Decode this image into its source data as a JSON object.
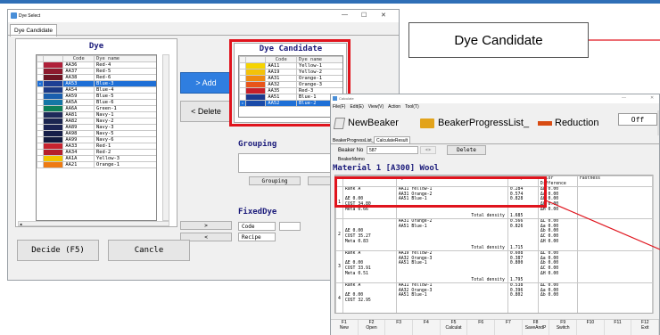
{
  "win1": {
    "title": "Dye Select",
    "tab": "Dye Candidate",
    "dye_panel": {
      "title": "Dye",
      "col_code": "Code",
      "col_name": "Dye name",
      "rows": [
        {
          "code": "AA36",
          "name": "Red-4",
          "color": "#b0203a"
        },
        {
          "code": "AA37",
          "name": "Red-5",
          "color": "#8e1a2e"
        },
        {
          "code": "AA38",
          "name": "Red-6",
          "color": "#6d1423"
        },
        {
          "code": "AA53",
          "name": "Blue-3",
          "color": "#1d3f95",
          "selected": true
        },
        {
          "code": "AA54",
          "name": "Blue-4",
          "color": "#1b3a86"
        },
        {
          "code": "AA59",
          "name": "Blue-5",
          "color": "#1a5fae"
        },
        {
          "code": "AA5A",
          "name": "Blue-6",
          "color": "#1477a6"
        },
        {
          "code": "AA6A",
          "name": "Green-1",
          "color": "#0f7f59"
        },
        {
          "code": "AA81",
          "name": "Navy-1",
          "color": "#1e2a5a"
        },
        {
          "code": "AA82",
          "name": "Navy-2",
          "color": "#1b2550"
        },
        {
          "code": "AA89",
          "name": "Navy-3",
          "color": "#1b2353"
        },
        {
          "code": "AA98",
          "name": "Navy-5",
          "color": "#151d48"
        },
        {
          "code": "AA99",
          "name": "Navy-6",
          "color": "#121a3f"
        },
        {
          "code": "AA33",
          "name": "Red-1",
          "color": "#c8232f"
        },
        {
          "code": "AA34",
          "name": "Red-2",
          "color": "#b51f2c"
        },
        {
          "code": "AA1A",
          "name": "Yellow-3",
          "color": "#f2c400"
        },
        {
          "code": "AA21",
          "name": "Orange-1",
          "color": "#ee7a12"
        }
      ]
    },
    "add_label": "> Add",
    "delete_label": "< Delete",
    "candidate_panel": {
      "title": "Dye Candidate",
      "col_code": "Code",
      "col_name": "Dye name",
      "rows": [
        {
          "code": "AA11",
          "name": "Yellow-1",
          "color": "#f6d400"
        },
        {
          "code": "AA19",
          "name": "Yellow-2",
          "color": "#f3c20a"
        },
        {
          "code": "AA31",
          "name": "Orange-1",
          "color": "#f08a10"
        },
        {
          "code": "AA32",
          "name": "Orange-3",
          "color": "#e8541a"
        },
        {
          "code": "AA35",
          "name": "Red-3",
          "color": "#c81f2a"
        },
        {
          "code": "AA51",
          "name": "Blue-1",
          "color": "#1c3a8f"
        },
        {
          "code": "AA52",
          "name": "Blue-2",
          "color": "#1a4aa8",
          "selected": true
        }
      ]
    },
    "grouping": {
      "title": "Grouping",
      "button": "Grouping"
    },
    "fixeddye": {
      "title": "FixedDye",
      "code_label": "Code",
      "recipe_label": "Recipe",
      "add": ">",
      "remove": "<"
    },
    "decide": "Decide (F5)",
    "cancel": "Cancle"
  },
  "callout": "Dye Candidate",
  "win2": {
    "title": "Calculate",
    "menu": [
      "File(F)",
      "Edit(E)",
      "View(V)",
      "Action",
      "Tool(T)"
    ],
    "toolbar": {
      "new": "NewBeaker",
      "progress": "BeakerProgressList_",
      "reduction": "Reduction",
      "off": "Off",
      "zoom": "875"
    },
    "tabs": [
      "BeakerProgressList_",
      "CalculateResult"
    ],
    "beaker_no_label": "Beaker No",
    "beaker_no_value": "587",
    "delete": "Delete",
    "beaker_memo_label": "BeakerMemo",
    "material": "Material  1 [A300] Wool",
    "headers": {
      "index": "Index",
      "combo": "DyeCombination",
      "recipe": "Recipe",
      "color": "Color Difference",
      "fast": "Fastness"
    },
    "results": [
      {
        "no": "1",
        "rank": "Rank A",
        "de": "ΔE  0.00",
        "cost": "COST 34.80",
        "meta": "Meta  0.66",
        "dyes": [
          "AA11  Yellow-1",
          "AA31  Orange-2",
          "AA51  Blue-1"
        ],
        "recipe": [
          "0.284",
          "0.574",
          "0.828"
        ],
        "diff": [
          "ΔL  0.00",
          "Δa  0.00",
          "Δb  0.00",
          "ΔC  0.00",
          "ΔH  0.00"
        ],
        "total": "1.685",
        "total_label": "Total density"
      },
      {
        "no": "2",
        "rank": "",
        "de": "ΔE  0.00",
        "cost": "COST 35.27",
        "meta": "Meta  0.83",
        "dyes": [
          "AA31  Orange-2",
          "AA51  Blue-1"
        ],
        "recipe": [
          "0.566",
          "0.826"
        ],
        "diff": [
          "ΔL  0.00",
          "Δa  0.00",
          "Δb  0.00",
          "ΔC  0.00",
          "ΔH  0.00"
        ],
        "total": "1.715",
        "total_label": "Total density"
      },
      {
        "no": "3",
        "rank": "Rank A",
        "de": "ΔE  0.00",
        "cost": "COST 33.91",
        "meta": "Meta  0.51",
        "dyes": [
          "AA19  Yellow-2",
          "AA32  Orange-3",
          "AA51  Blue-1"
        ],
        "recipe": [
          "0.608",
          "0.387",
          "0.800"
        ],
        "diff": [
          "ΔL  0.00",
          "Δa  0.00",
          "Δb  0.00",
          "ΔC  0.00",
          "ΔH  0.00"
        ],
        "total": "1.795",
        "total_label": "Total density"
      },
      {
        "no": "4",
        "rank": "Rank A",
        "de": "ΔE  0.00",
        "cost": "COST 32.95",
        "meta": "",
        "dyes": [
          "AA11  Yellow-1",
          "AA32  Orange-3",
          "AA51  Blue-1"
        ],
        "recipe": [
          "0.538",
          "0.396",
          "0.802"
        ],
        "diff": [
          "ΔL  0.00",
          "Δa  0.00",
          "Δb  0.00"
        ],
        "total": "",
        "total_label": ""
      }
    ],
    "fkeys": [
      {
        "k": "F1",
        "l": "New"
      },
      {
        "k": "F2",
        "l": "Open"
      },
      {
        "k": "F3",
        "l": ""
      },
      {
        "k": "F4",
        "l": ""
      },
      {
        "k": "F5",
        "l": "Calculat"
      },
      {
        "k": "F6",
        "l": ""
      },
      {
        "k": "F7",
        "l": ""
      },
      {
        "k": "F8",
        "l": "SaveAndP"
      },
      {
        "k": "F9",
        "l": "Switch"
      },
      {
        "k": "F10",
        "l": ""
      },
      {
        "k": "F11",
        "l": ""
      },
      {
        "k": "F12",
        "l": "Exit"
      }
    ]
  }
}
